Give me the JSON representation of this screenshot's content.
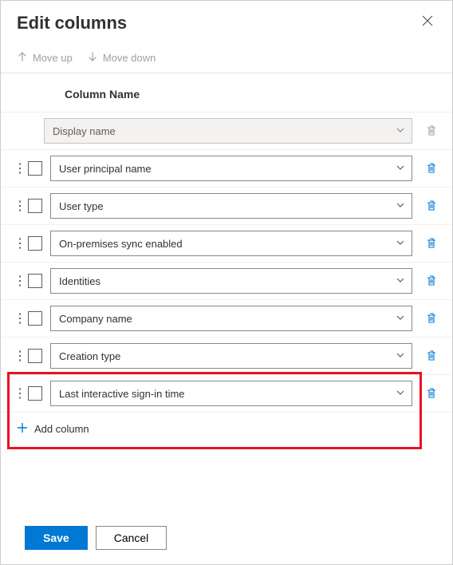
{
  "title": "Edit columns",
  "toolbar": {
    "move_up": "Move up",
    "move_down": "Move down"
  },
  "column_header": "Column Name",
  "columns": {
    "locked": "Display name",
    "items": [
      "User principal name",
      "User type",
      "On-premises sync enabled",
      "Identities",
      "Company name",
      "Creation type",
      "Last interactive sign-in time"
    ]
  },
  "add_column": "Add column",
  "buttons": {
    "save": "Save",
    "cancel": "Cancel"
  }
}
